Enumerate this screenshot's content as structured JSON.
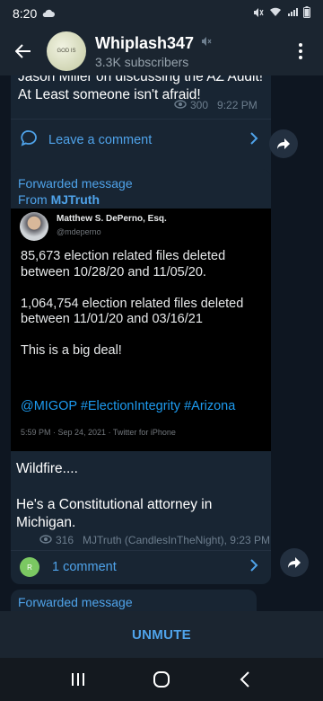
{
  "status_bar": {
    "time": "8:20"
  },
  "header": {
    "title": "Whiplash347",
    "subtitle": "3.3K subscribers",
    "avatar_text": "GOD IS"
  },
  "messages": [
    {
      "text": "Jason Miller on discussing the AZ Audit!  At Least someone isn't afraid!",
      "views": "300",
      "time": "9:22 PM",
      "comment_label": "Leave a comment"
    },
    {
      "forwarded_label": "Forwarded message",
      "forwarded_from_prefix": "From ",
      "forwarded_from": "MJTruth",
      "tweet": {
        "author": "Matthew S. DePerno, Esq.",
        "handle": "@mdeperno",
        "paragraphs": [
          "85,673 election related files deleted between 10/28/20 and 11/05/20.",
          "1,064,754 election related files deleted between 11/01/20 and 03/16/21",
          "This is a big deal!"
        ],
        "hashtags": "@MIGOP #ElectionIntegrity #Arizona",
        "footer": "5:59 PM · Sep 24, 2021 · Twitter for iPhone"
      },
      "caption_line1": "Wildfire....",
      "caption_line2": "He's a Constitutional attorney in Michigan.",
      "views": "316",
      "signature": "MJTruth (CandlesInTheNight), 9:23 PM",
      "comment_avatar_text": "R",
      "comment_label": "1 comment"
    },
    {
      "forwarded_label": "Forwarded message"
    }
  ],
  "bottom": {
    "unmute_label": "UNMUTE"
  },
  "colors": {
    "accent": "#4fa3ea",
    "background": "#0e1621",
    "bubble": "#182533"
  }
}
